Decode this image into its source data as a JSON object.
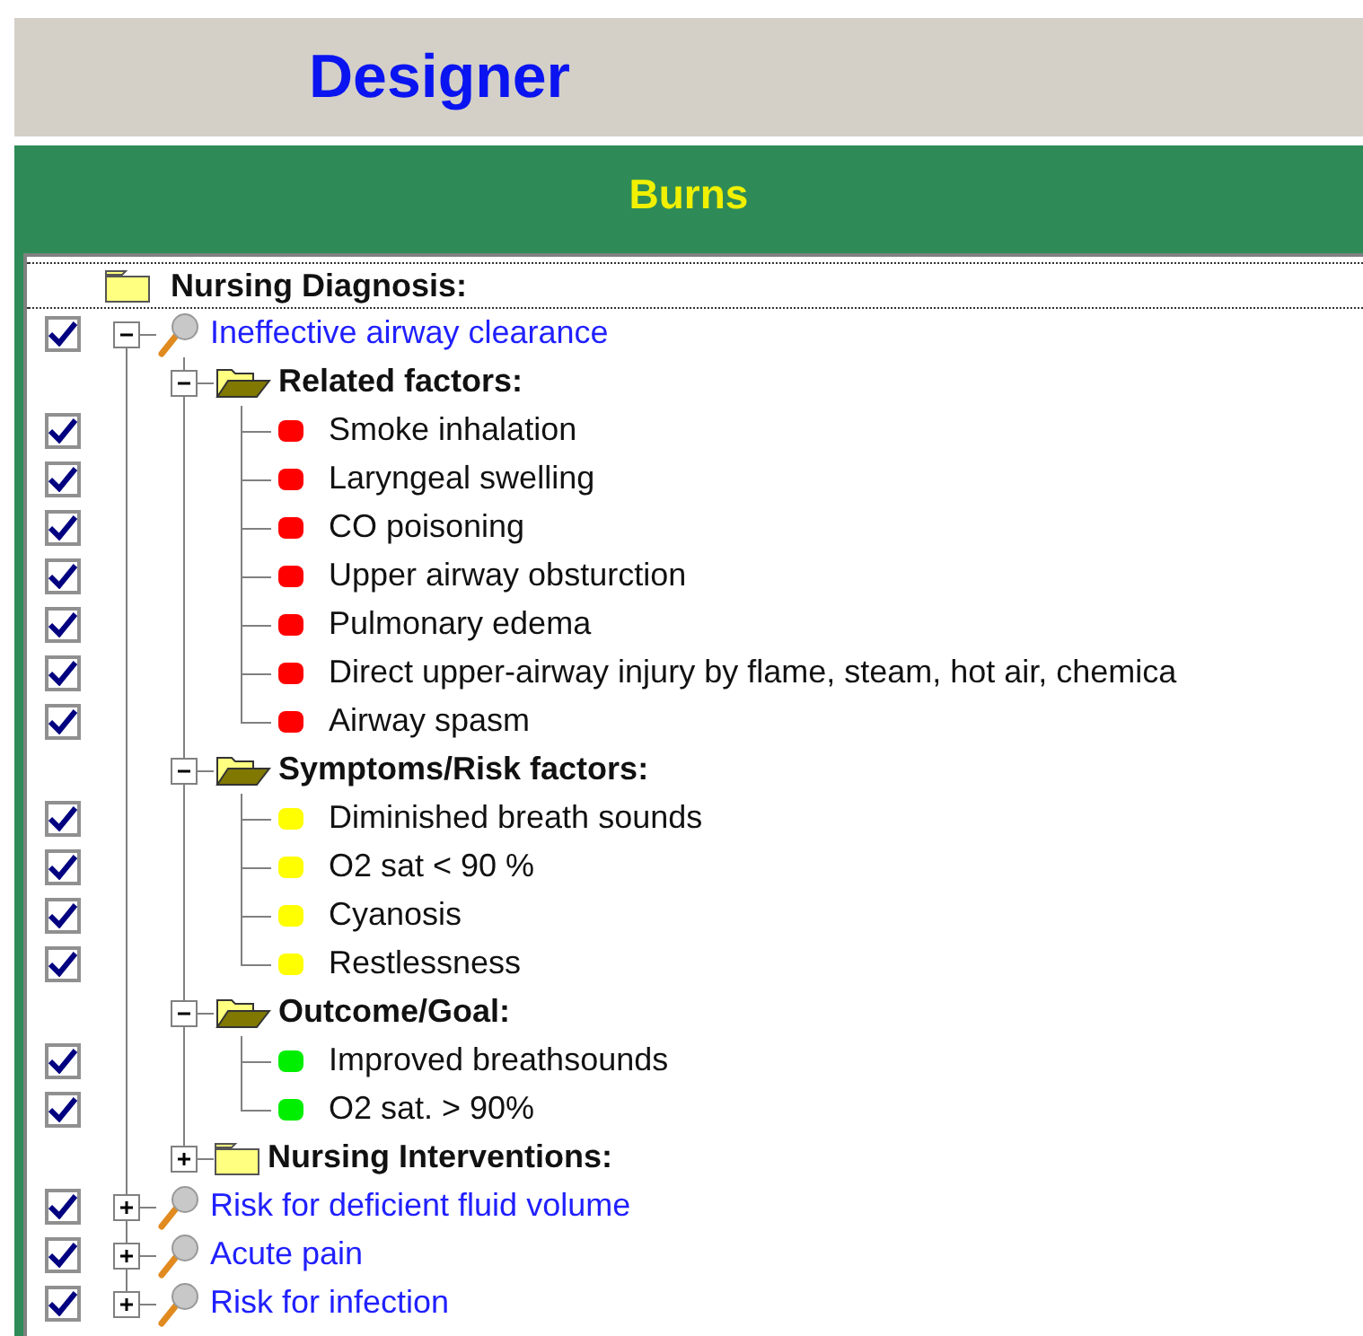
{
  "header": {
    "title": "Designer"
  },
  "banner": {
    "title": "Burns"
  },
  "tree": {
    "label": "Nursing Diagnosis:",
    "children": [
      {
        "label": "Ineffective airway clearance",
        "checked": true,
        "expanded": true,
        "children": [
          {
            "label": "Related factors:",
            "expanded": true,
            "children": [
              {
                "label": "Smoke inhalation",
                "checked": true,
                "color": "#ff0000"
              },
              {
                "label": "Laryngeal swelling",
                "checked": true,
                "color": "#ff0000"
              },
              {
                "label": "CO poisoning",
                "checked": true,
                "color": "#ff0000"
              },
              {
                "label": "Upper airway obsturction",
                "checked": true,
                "color": "#ff0000"
              },
              {
                "label": "Pulmonary edema",
                "checked": true,
                "color": "#ff0000"
              },
              {
                "label": "Direct upper-airway injury by flame, steam, hot air, chemica",
                "checked": true,
                "color": "#ff0000"
              },
              {
                "label": "Airway spasm",
                "checked": true,
                "color": "#ff0000"
              }
            ]
          },
          {
            "label": "Symptoms/Risk factors:",
            "expanded": true,
            "children": [
              {
                "label": "Diminished breath sounds",
                "checked": true,
                "color": "#ffff00"
              },
              {
                "label": "O2 sat < 90 %",
                "checked": true,
                "color": "#ffff00"
              },
              {
                "label": "Cyanosis",
                "checked": true,
                "color": "#ffff00"
              },
              {
                "label": "Restlessness",
                "checked": true,
                "color": "#ffff00"
              }
            ]
          },
          {
            "label": "Outcome/Goal:",
            "expanded": true,
            "children": [
              {
                "label": "Improved breathsounds",
                "checked": true,
                "color": "#00ee00"
              },
              {
                "label": "O2  sat. > 90%",
                "checked": true,
                "color": "#00ee00"
              }
            ]
          },
          {
            "label": "Nursing Interventions:",
            "expanded": false
          }
        ]
      },
      {
        "label": "Risk for deficient fluid volume",
        "checked": true,
        "expanded": false
      },
      {
        "label": "Acute pain",
        "checked": true,
        "expanded": false
      },
      {
        "label": "Risk for infection",
        "checked": true,
        "expanded": false
      }
    ]
  }
}
